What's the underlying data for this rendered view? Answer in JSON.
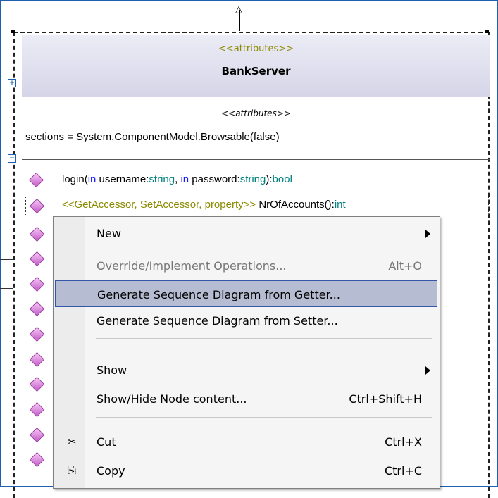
{
  "class": {
    "stereotype": "<<attributes>>",
    "name": "BankServer",
    "attr_stereotype": "<<attributes>>",
    "attribute": "sections = System.ComponentModel.Browsable(false)"
  },
  "operations": [
    {
      "parts": [
        [
          "login(",
          ""
        ],
        [
          "in",
          "kw"
        ],
        [
          " username:",
          ""
        ],
        [
          "string",
          "tp"
        ],
        [
          ", ",
          ""
        ],
        [
          "in",
          "kw"
        ],
        [
          " password:",
          ""
        ],
        [
          "string",
          "tp"
        ],
        [
          "):",
          ""
        ],
        [
          "bool",
          "tp"
        ]
      ]
    },
    {
      "parts": [
        [
          "<<GetAccessor, SetAccessor, property>>",
          "st"
        ],
        [
          " NrOfAccounts():",
          ""
        ],
        [
          "int",
          "tp"
        ]
      ]
    }
  ],
  "menu": {
    "items": [
      {
        "label": "New",
        "shortcut": "",
        "submenu": true,
        "disabled": false,
        "highlighted": false,
        "icon": ""
      },
      {
        "label": "Override/Implement Operations...",
        "shortcut": "Alt+O",
        "submenu": false,
        "disabled": true,
        "highlighted": false,
        "icon": ""
      },
      {
        "label": "Generate Sequence Diagram from Getter...",
        "shortcut": "",
        "submenu": false,
        "disabled": false,
        "highlighted": true,
        "icon": ""
      },
      {
        "label": "Generate Sequence Diagram from Setter...",
        "shortcut": "",
        "submenu": false,
        "disabled": false,
        "highlighted": false,
        "icon": ""
      },
      {
        "label": "Show",
        "shortcut": "",
        "submenu": true,
        "disabled": false,
        "highlighted": false,
        "icon": ""
      },
      {
        "label": "Show/Hide Node content...",
        "shortcut": "Ctrl+Shift+H",
        "submenu": false,
        "disabled": false,
        "highlighted": false,
        "icon": ""
      },
      {
        "label": "Cut",
        "shortcut": "Ctrl+X",
        "submenu": false,
        "disabled": false,
        "highlighted": false,
        "icon": "scissors-icon"
      },
      {
        "label": "Copy",
        "shortcut": "Ctrl+C",
        "submenu": false,
        "disabled": false,
        "highlighted": false,
        "icon": "copy-icon"
      }
    ]
  },
  "colors": {
    "frame": "#1f5fb0",
    "highlight": "#b6bdd2",
    "stereotype": "#8a8a00",
    "keyword": "#1a1aff",
    "type": "#008080"
  }
}
